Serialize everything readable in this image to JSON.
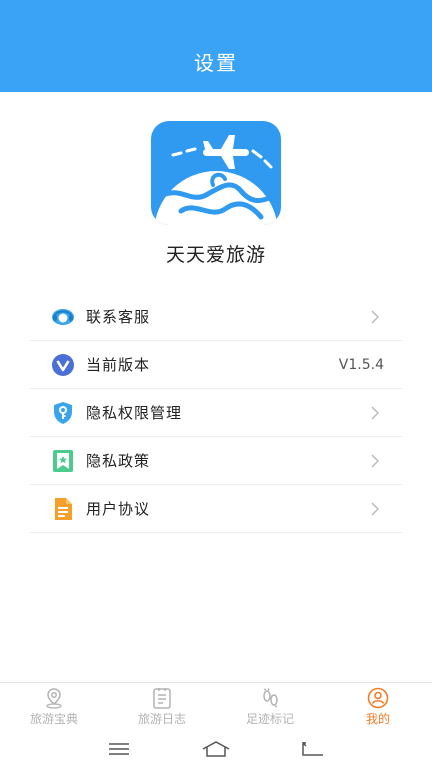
{
  "header": {
    "title": "设置"
  },
  "app": {
    "name": "天天爱旅游",
    "logo_icon": "globe-plane-logo"
  },
  "menu": [
    {
      "label": "联系客服",
      "icon": "customer-service-icon",
      "value": "",
      "has_chevron": true
    },
    {
      "label": "当前版本",
      "icon": "version-icon",
      "value": "V1.5.4",
      "has_chevron": false
    },
    {
      "label": "隐私权限管理",
      "icon": "shield-key-icon",
      "value": "",
      "has_chevron": true
    },
    {
      "label": "隐私政策",
      "icon": "bookmark-star-icon",
      "value": "",
      "has_chevron": true
    },
    {
      "label": "用户协议",
      "icon": "document-icon",
      "value": "",
      "has_chevron": true
    }
  ],
  "tabbar": {
    "tabs": [
      {
        "label": "旅游宝典",
        "icon": "map-pin-icon",
        "active": false
      },
      {
        "label": "旅游日志",
        "icon": "notebook-icon",
        "active": false
      },
      {
        "label": "足迹标记",
        "icon": "footprint-icon",
        "active": false
      },
      {
        "label": "我的",
        "icon": "user-icon",
        "active": true
      }
    ]
  },
  "colors": {
    "header": "#3ba3f5",
    "active_tab": "#f07d27",
    "inactive_tab": "#b3b3b3"
  }
}
